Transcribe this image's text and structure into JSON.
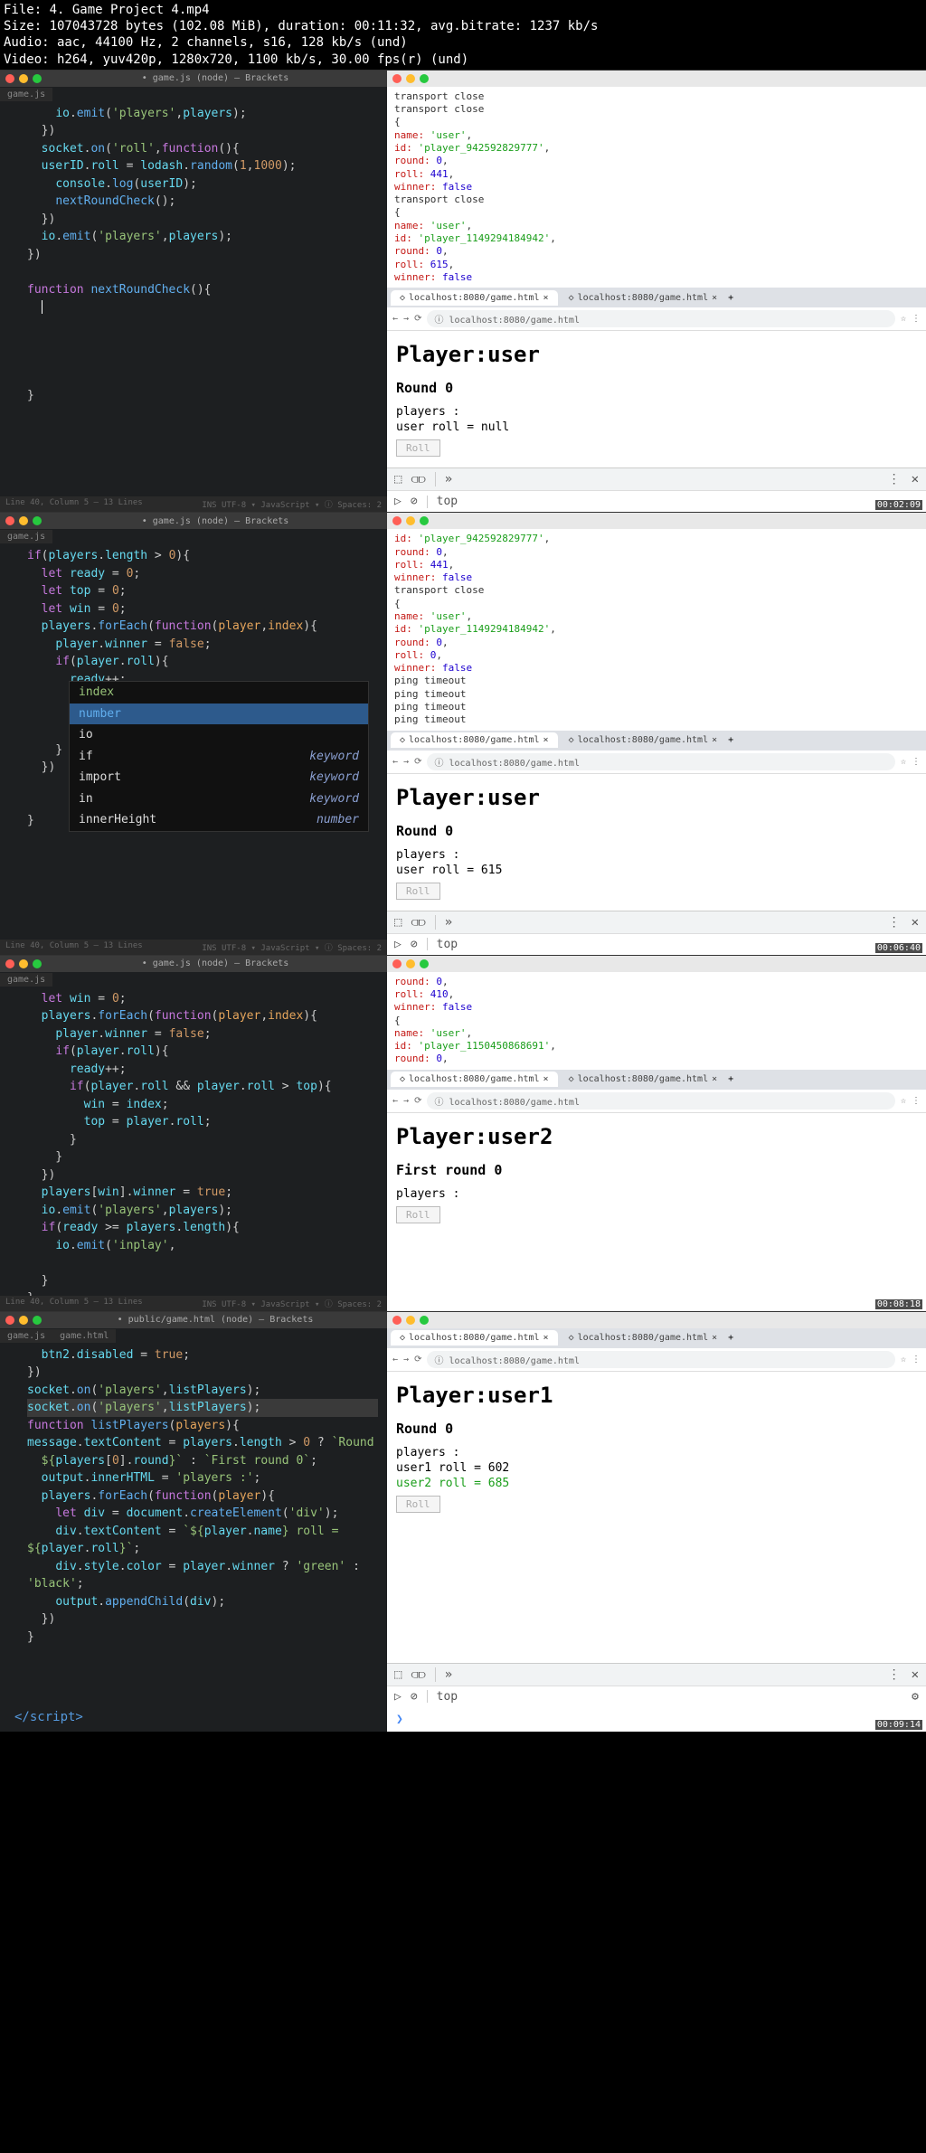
{
  "fileinfo": {
    "line1": "File: 4. Game Project 4.mp4",
    "line2": "Size: 107043728 bytes (102.08 MiB), duration: 00:11:32, avg.bitrate: 1237 kb/s",
    "line3": "Audio: aac, 44100 Hz, 2 channels, s16, 128 kb/s (und)",
    "line4": "Video: h264, yuv420p, 1280x720, 1100 kb/s, 30.00 fps(r) (und)"
  },
  "editor_title": "• game.js (node) — Brackets",
  "editor_title4": "• public/game.html (node) — Brackets",
  "tab_name": "game.js",
  "tab_name2": "game.html",
  "panel1": {
    "terminal": [
      {
        "t": "plain",
        "v": "transport close"
      },
      {
        "t": "plain",
        "v": "transport close"
      },
      {
        "t": "plain",
        "v": "{"
      },
      {
        "t": "kv",
        "k": "  name:",
        "s": "'user'",
        "e": ","
      },
      {
        "t": "kv",
        "k": "  id:",
        "s": "'player_942592829777'",
        "e": ","
      },
      {
        "t": "kv",
        "k": "  round:",
        "n": "0",
        "e": ","
      },
      {
        "t": "kv",
        "k": "  roll:",
        "n": "441",
        "e": ","
      },
      {
        "t": "kv",
        "k": "  winner:",
        "b": "false"
      },
      {
        "t": "plain",
        "v": "transport close"
      },
      {
        "t": "plain",
        "v": "{"
      },
      {
        "t": "kv",
        "k": "  name:",
        "s": "'user'",
        "e": ","
      },
      {
        "t": "kv",
        "k": "  id:",
        "s": "'player_1149294184942'",
        "e": ","
      },
      {
        "t": "kv",
        "k": "  round:",
        "n": "0",
        "e": ","
      },
      {
        "t": "kv",
        "k": "  roll:",
        "n": "615",
        "e": ","
      },
      {
        "t": "kv",
        "k": "  winner:",
        "b": "false"
      }
    ],
    "page_h1": "Player:user",
    "page_h3": "Round 0",
    "players": "players :",
    "roll_line": "user roll = null",
    "btn": "Roll",
    "ts": "00:02:09"
  },
  "panel2": {
    "terminal": [
      {
        "t": "kv",
        "k": "  id:",
        "s": "'player_942592829777'",
        "e": ","
      },
      {
        "t": "kv",
        "k": "  round:",
        "n": "0",
        "e": ","
      },
      {
        "t": "kv",
        "k": "  roll:",
        "n": "441",
        "e": ","
      },
      {
        "t": "kv",
        "k": "  winner:",
        "b": "false"
      },
      {
        "t": "plain",
        "v": "transport close"
      },
      {
        "t": "plain",
        "v": "{"
      },
      {
        "t": "kv",
        "k": "  name:",
        "s": "'user'",
        "e": ","
      },
      {
        "t": "kv",
        "k": "  id:",
        "s": "'player_1149294184942'",
        "e": ","
      },
      {
        "t": "kv",
        "k": "  round:",
        "n": "0",
        "e": ","
      },
      {
        "t": "kv",
        "k": "  roll:",
        "n": "0",
        "e": ","
      },
      {
        "t": "kv",
        "k": "  winner:",
        "b": "false"
      },
      {
        "t": "plain",
        "v": "ping timeout"
      },
      {
        "t": "plain",
        "v": "ping timeout"
      },
      {
        "t": "plain",
        "v": "ping timeout"
      },
      {
        "t": "plain",
        "v": "ping timeout"
      }
    ],
    "page_h1": "Player:user",
    "page_h3": "Round 0",
    "players": "players :",
    "roll_line": "user roll = 615",
    "btn": "Roll",
    "ac": [
      {
        "l": "index",
        "r": ""
      },
      {
        "l": "number",
        "r": ""
      },
      {
        "l": "io",
        "r": ""
      },
      {
        "l": "if",
        "r": "keyword"
      },
      {
        "l": "import",
        "r": "keyword"
      },
      {
        "l": "in",
        "r": "keyword"
      },
      {
        "l": "innerHeight",
        "r": "number"
      }
    ],
    "ts": "00:06:40"
  },
  "panel3": {
    "terminal": [
      {
        "t": "kv",
        "k": "  round:",
        "n": "0",
        "e": ","
      },
      {
        "t": "kv",
        "k": "  roll:",
        "n": "410",
        "e": ","
      },
      {
        "t": "kv",
        "k": "  winner:",
        "b": "false"
      },
      {
        "t": "plain",
        "v": "{"
      },
      {
        "t": "kv",
        "k": "  name:",
        "s": "'user'",
        "e": ","
      },
      {
        "t": "kv",
        "k": "  id:",
        "s": "'player_1150450868691'",
        "e": ","
      },
      {
        "t": "kv",
        "k": "  round:",
        "n": "0",
        "e": ","
      }
    ],
    "page_h1": "Player:user2",
    "page_h3": "First round 0",
    "players": "players :",
    "btn": "Roll",
    "ts": "00:08:18"
  },
  "panel4": {
    "page_h1": "Player:user1",
    "page_h3": "Round 0",
    "players": "players :",
    "roll1": "user1 roll = 602",
    "roll2": "user2 roll = 685",
    "btn": "Roll",
    "console_top": "top",
    "script_close": "</script>",
    "ts": "00:09:14"
  },
  "browser": {
    "tab1": "localhost:8080/game.html",
    "tab2": "localhost:8080/game.html",
    "url": "localhost:8080/game.html",
    "star": "☆",
    "menu": "⋮"
  },
  "status": {
    "left": "Line 40, Column 5 — 13 Lines",
    "right": "INS  UTF-8 ▾  JavaScript ▾  ⓘ  Spaces: 2"
  }
}
